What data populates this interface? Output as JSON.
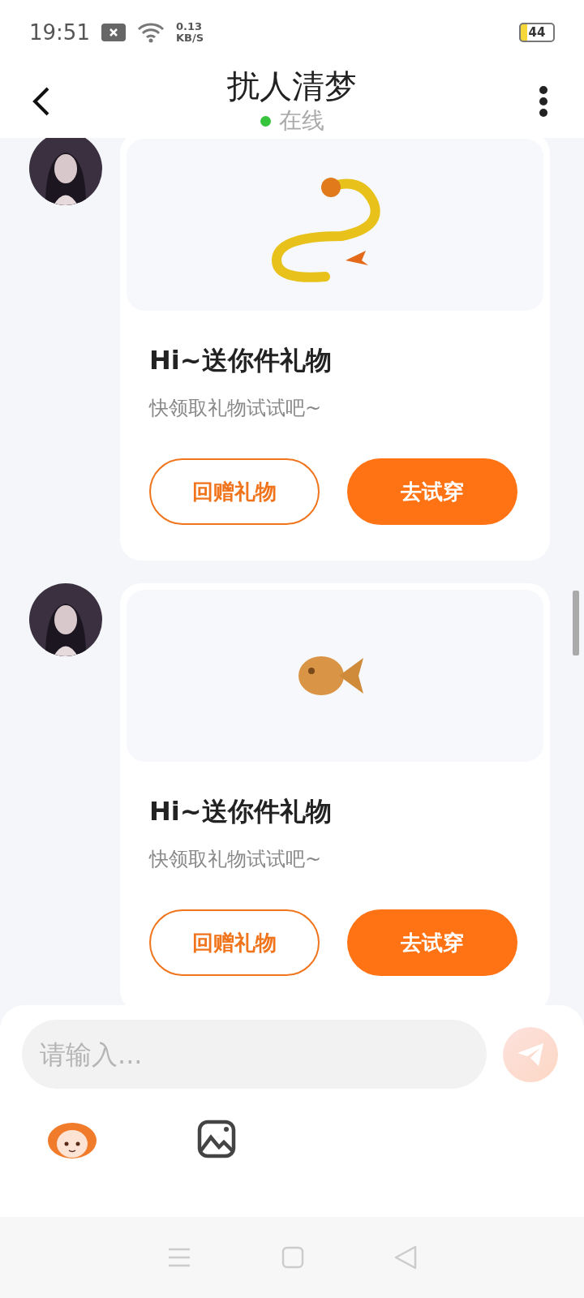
{
  "status_bar": {
    "time": "19:51",
    "net_speed_value": "0.13",
    "net_speed_unit": "KB/S",
    "battery": "44"
  },
  "header": {
    "title": "扰人清梦",
    "status": "在线",
    "online": true
  },
  "messages": [
    {
      "kind": "gift",
      "title": "Hi~送你件礼物",
      "subtitle": "快领取礼物试试吧~",
      "buttons": [
        {
          "label": "回赠礼物",
          "kind": "outline"
        },
        {
          "label": "去试穿",
          "kind": "filled"
        }
      ]
    },
    {
      "kind": "gift",
      "title": "Hi~送你件礼物",
      "subtitle": "快领取礼物试试吧~",
      "buttons": [
        {
          "label": "回赠礼物",
          "kind": "outline"
        },
        {
          "label": "去试穿",
          "kind": "filled"
        }
      ]
    }
  ],
  "composer": {
    "placeholder": "请输入..."
  }
}
